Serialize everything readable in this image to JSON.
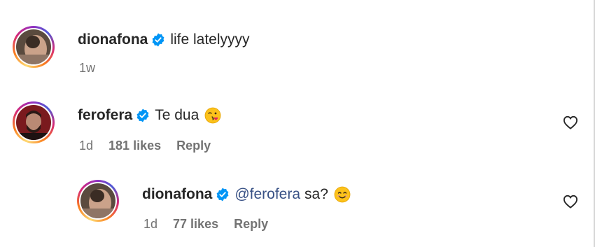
{
  "comments": [
    {
      "username": "dionafona",
      "text": "life latelyyyy",
      "time": "1w"
    },
    {
      "username": "ferofera",
      "text": "Te dua",
      "emoji": "kissing-wink-emoji",
      "time": "1d",
      "likes": "181 likes",
      "reply_label": "Reply"
    }
  ],
  "reply": {
    "username": "dionafona",
    "mention": "@ferofera",
    "text": "sa?",
    "emoji": "smiling-emoji",
    "time": "1d",
    "likes": "77 likes",
    "reply_label": "Reply"
  },
  "colors": {
    "verified": "#0095f6",
    "mention": "#385185",
    "meta": "#737373"
  }
}
